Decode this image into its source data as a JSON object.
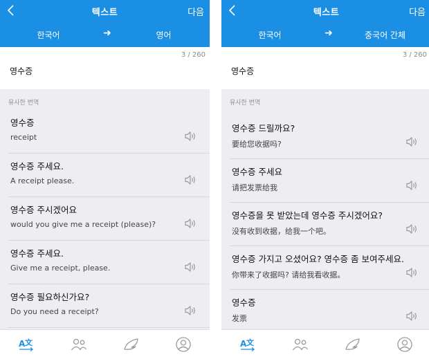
{
  "colors": {
    "accent": "#1b8fe4",
    "list_bg": "#eeeef2",
    "icon_gray": "#9a9a9a"
  },
  "screens": [
    {
      "header": {
        "back_icon": "chevron-left-icon",
        "title": "텍스트",
        "next_label": "다음"
      },
      "langbar": {
        "from": "한국어",
        "arrow": "➜",
        "to": "영어"
      },
      "input": {
        "count": "3 / 260",
        "text": "영수증"
      },
      "similar_label": "유사한 번역",
      "items": [
        {
          "korean": "영수증",
          "translation": "receipt"
        },
        {
          "korean": "영수증 주세요.",
          "translation": "A receipt please."
        },
        {
          "korean": "영수증 주시겠어요",
          "translation": "would you give me a receipt (please)?"
        },
        {
          "korean": "영수증 주세요.",
          "translation": "Give me a receipt, please."
        },
        {
          "korean": "영수증 필요하신가요?",
          "translation": "Do you need a receipt?"
        }
      ],
      "tabs": [
        "translate-icon",
        "people-icon",
        "wing-icon",
        "profile-icon"
      ]
    },
    {
      "header": {
        "back_icon": "chevron-left-icon",
        "title": "텍스트",
        "next_label": "다음"
      },
      "langbar": {
        "from": "한국어",
        "arrow": "➜",
        "to": "중국어 간체"
      },
      "input": {
        "count": "3 / 260",
        "text": "영수증"
      },
      "similar_label": "유사한 번역",
      "items": [
        {
          "korean": "영수증 드릴까요?",
          "translation": "要给您收据吗?"
        },
        {
          "korean": "영수증 주세요",
          "translation": "请把发票给我"
        },
        {
          "korean": "영수증을 못 받았는데 영수증 주시겠어요?",
          "translation": "没有收到收据，给我一个吧。"
        },
        {
          "korean": "영수증 가지고 오셨어요? 영수증 좀 보여주세요.",
          "translation": "你带来了收据吗? 请给我看收据。"
        },
        {
          "korean": "영수증",
          "translation": "发票"
        }
      ],
      "tabs": [
        "translate-icon",
        "people-icon",
        "wing-icon",
        "profile-icon"
      ]
    }
  ]
}
